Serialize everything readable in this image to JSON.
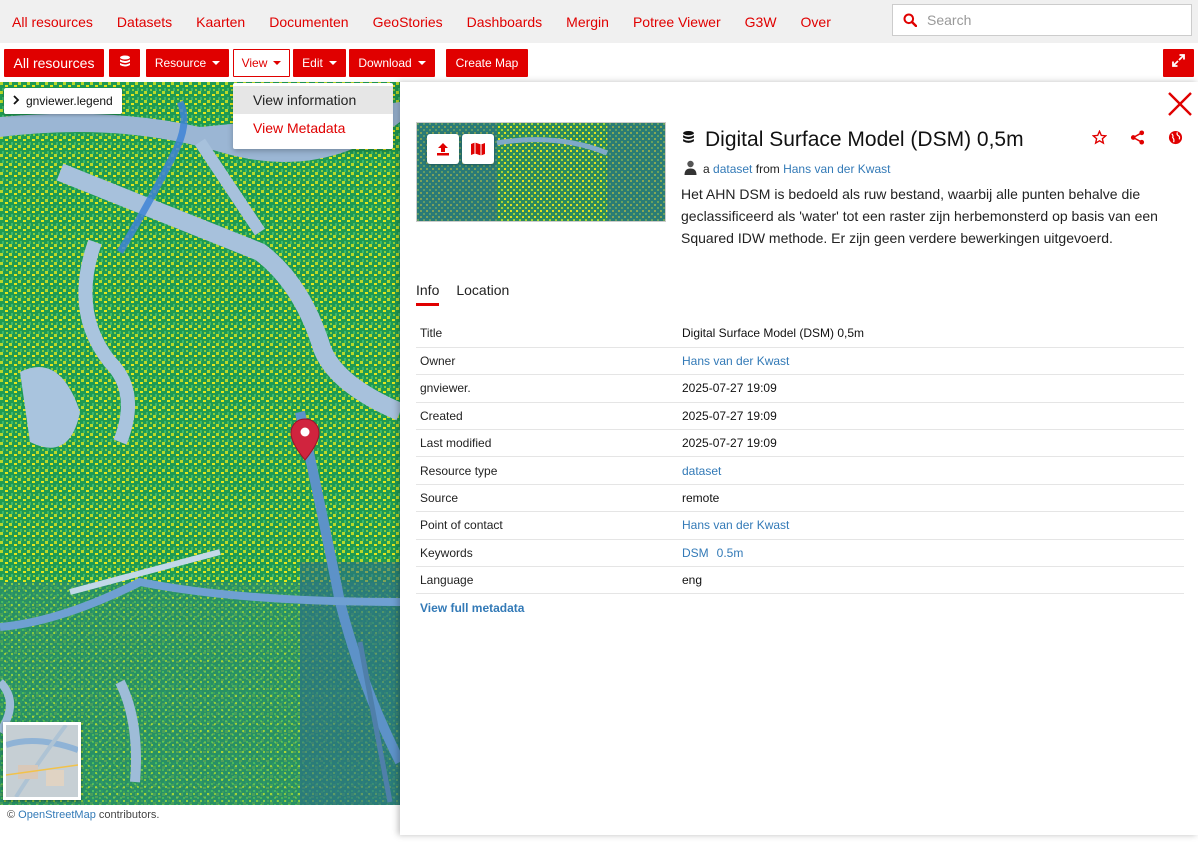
{
  "nav": {
    "links": [
      "All resources",
      "Datasets",
      "Kaarten",
      "Documenten",
      "GeoStories",
      "Dashboards",
      "Mergin",
      "Potree Viewer",
      "G3W",
      "Over"
    ],
    "search_placeholder": "Search"
  },
  "toolbar": {
    "all_resources": "All resources",
    "resource": "Resource",
    "view": "View",
    "edit": "Edit",
    "download": "Download",
    "create_map": "Create Map"
  },
  "dropdown": {
    "view_information": "View information",
    "view_metadata": "View Metadata"
  },
  "map": {
    "legend_label": "gnviewer.legend",
    "attribution_prefix": "©",
    "attribution_link": "OpenStreetMap",
    "attribution_suffix": "contributors."
  },
  "resource": {
    "title": "Digital Surface Model (DSM) 0,5m",
    "byline_a": "a",
    "byline_type": "dataset",
    "byline_from": "from",
    "byline_owner": "Hans van der Kwast",
    "description": "Het AHN DSM is bedoeld als ruw bestand, waarbij alle punten behalve die geclassificeerd als 'water' tot een raster zijn herbemonsterd op basis van een Squared IDW methode. Er zijn geen verdere bewerkingen uitgevoerd."
  },
  "tabs": [
    "Info",
    "Location"
  ],
  "info": {
    "rows": [
      {
        "key": "Title",
        "value": "Digital Surface Model (DSM) 0,5m"
      },
      {
        "key": "Owner",
        "value": "Hans van der Kwast"
      },
      {
        "key": "gnviewer.",
        "value": "2025-07-27 19:09"
      },
      {
        "key": "Created",
        "value": "2025-07-27 19:09"
      },
      {
        "key": "Last modified",
        "value": "2025-07-27 19:09"
      },
      {
        "key": "Resource type",
        "value": "dataset"
      },
      {
        "key": "Source",
        "value": "remote"
      },
      {
        "key": "Point of contact",
        "value": "Hans van der Kwast"
      },
      {
        "key": "Keywords",
        "value": ""
      },
      {
        "key": "Language",
        "value": "eng"
      }
    ],
    "keywords": [
      "DSM",
      "0.5m"
    ],
    "view_full_metadata": "View full metadata"
  },
  "colors": {
    "accent": "#e00000",
    "link": "#337ab7"
  },
  "icons": [
    "search-icon",
    "database-icon",
    "expand-icon",
    "chevron-right-icon",
    "map-marker-icon",
    "close-icon",
    "upload-icon",
    "map-icon",
    "star-icon",
    "share-icon",
    "globe-icon",
    "user-icon"
  ]
}
